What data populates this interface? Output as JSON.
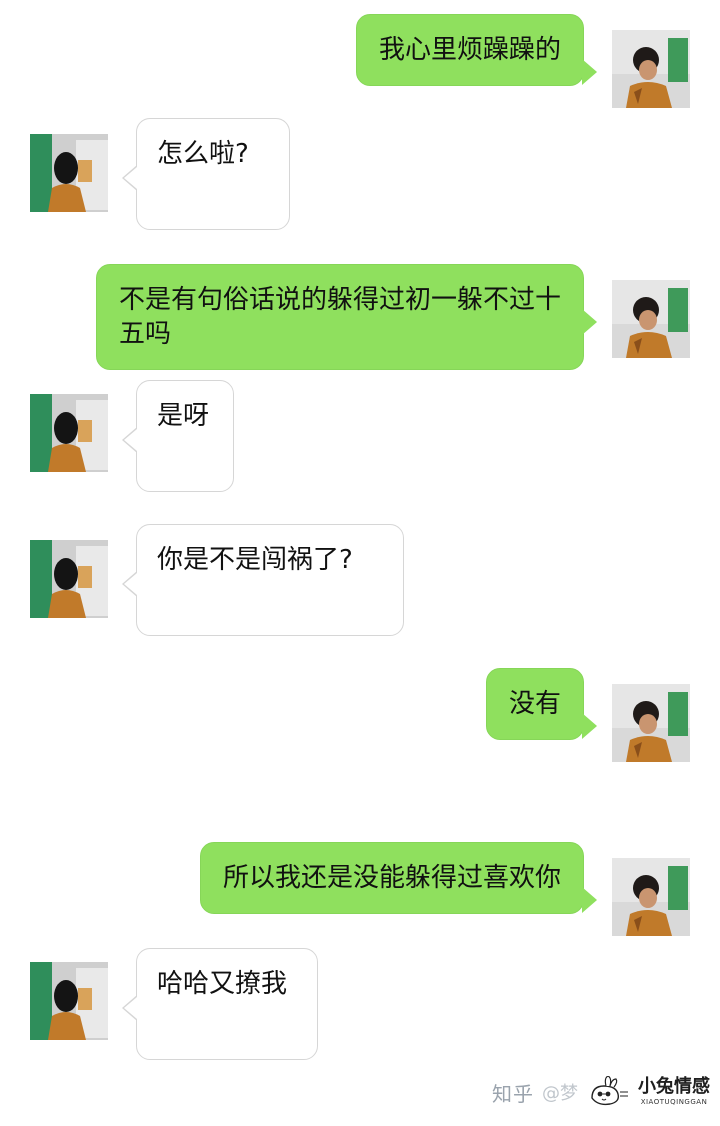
{
  "messages": [
    {
      "side": "right",
      "text": "我心里烦躁躁的"
    },
    {
      "side": "left",
      "text": "怎么啦?"
    },
    {
      "side": "right",
      "text": "不是有句俗话说的躲得过初一躲不过十五吗"
    },
    {
      "side": "left",
      "text": "是呀"
    },
    {
      "side": "left",
      "text": "你是不是闯祸了?"
    },
    {
      "side": "right",
      "text": "没有"
    },
    {
      "side": "right",
      "text": "所以我还是没能躲得过喜欢你"
    },
    {
      "side": "left",
      "text": "哈哈又撩我"
    }
  ],
  "watermark": {
    "zhihu": "知乎",
    "handle": "@梦",
    "brand": "小兔情感",
    "brand_pinyin": "XIAOTUQINGGAN"
  },
  "colors": {
    "sent_bubble": "#8fe05e",
    "received_bubble": "#ffffff",
    "received_border": "#d6d6d6"
  }
}
